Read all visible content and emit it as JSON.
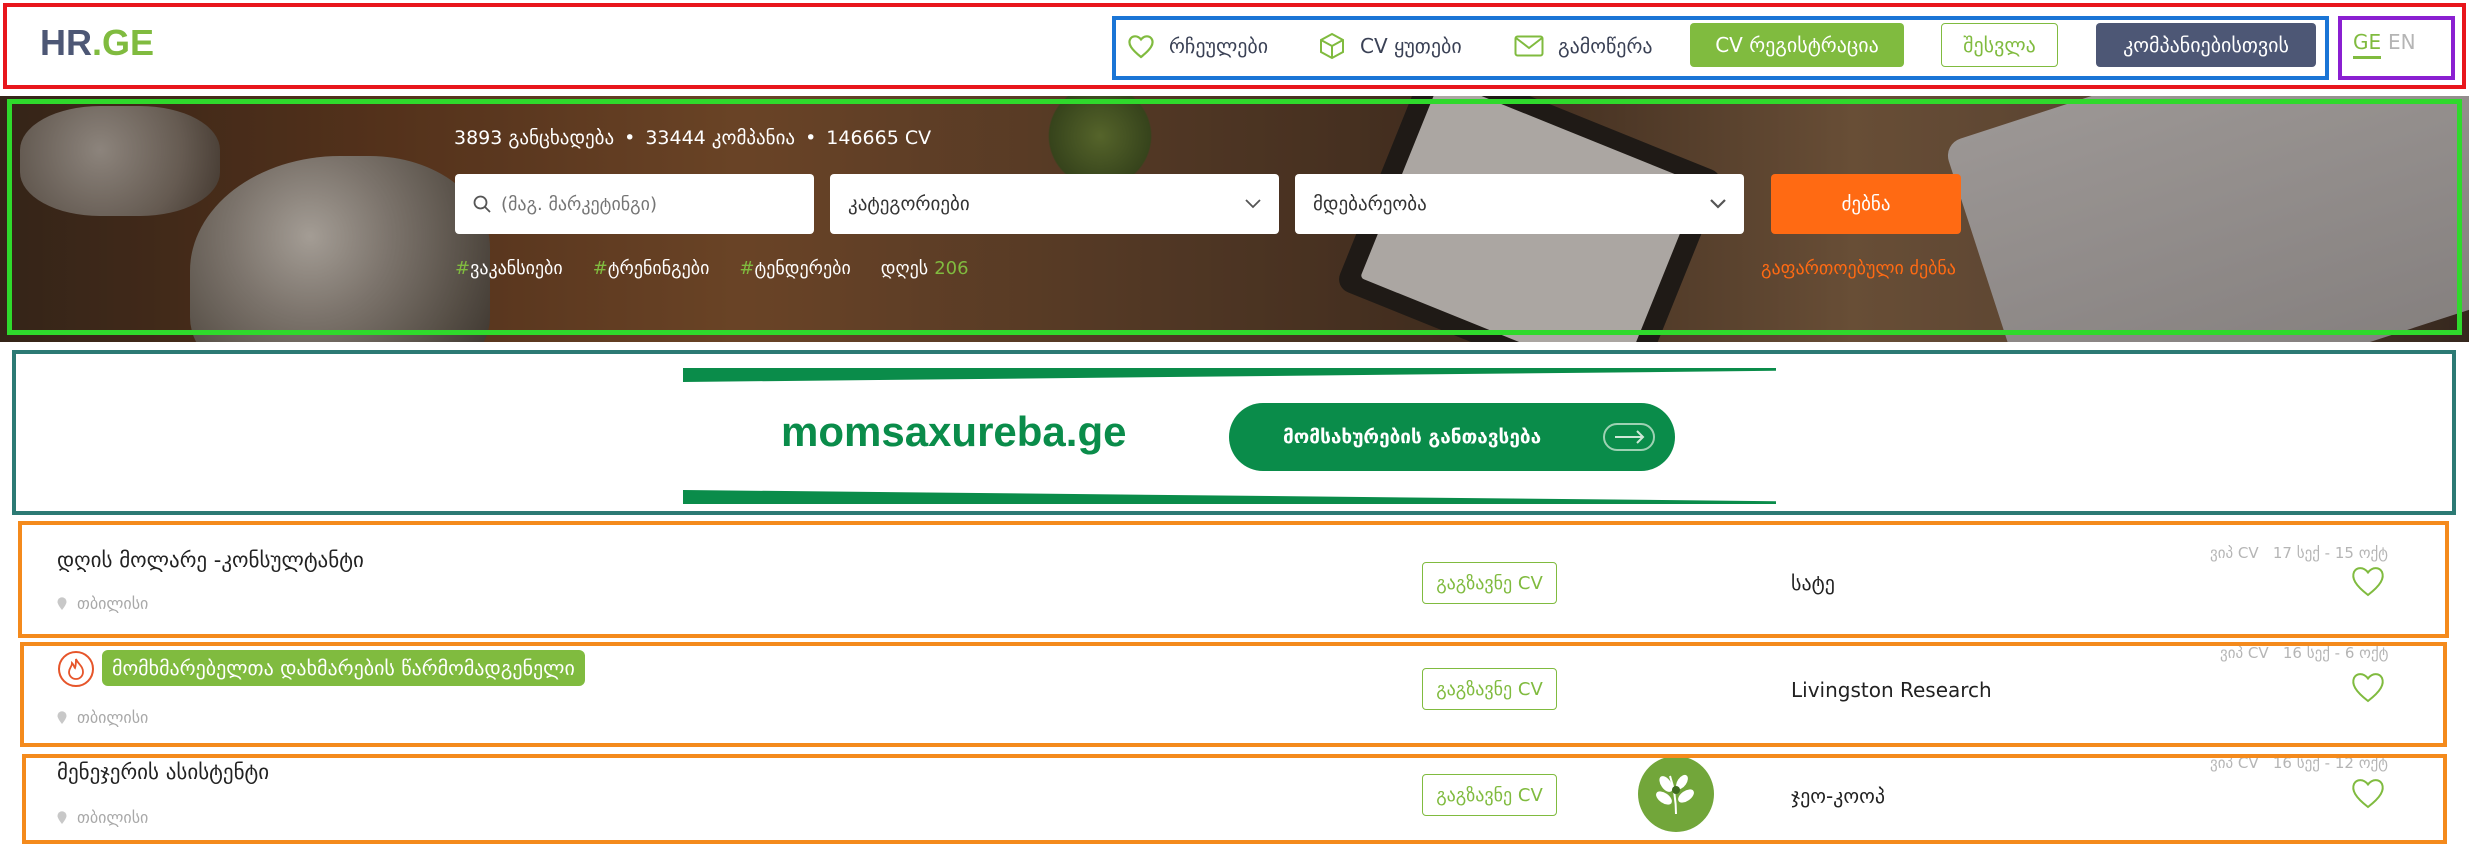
{
  "header": {
    "logo_hr": "HR",
    "logo_ge": ".GE",
    "nav": {
      "favorites": "რჩეულები",
      "cv_boxes": "CV ყუთები",
      "subscribe": "გამოწერა"
    },
    "cv_registration": "CV რეგისტრაცია",
    "login": "შესვლა",
    "for_companies": "კომპანიებისთვის",
    "lang_ge": "GE",
    "lang_en": "EN"
  },
  "hero": {
    "stats": {
      "applications": "3893 განცხადება",
      "companies": "33444 კომპანია",
      "cv": "146665 CV"
    },
    "search_placeholder": "(მაგ. მარკეტინგი)",
    "category_label": "კატეგორიები",
    "location_label": "მდებარეობა",
    "search_button": "ძებნა",
    "tags": [
      "ვაკანსიები",
      "ტრენინგები",
      "ტენდერები"
    ],
    "today_label": "დღეს",
    "today_count": "206",
    "advanced_search": "გაფართოებული ძებნა"
  },
  "banner": {
    "brand": "momsaxureba.ge",
    "button_label": "მომსახურების განთავსება"
  },
  "jobs": [
    {
      "title": "დღის მოლარე -კონსულტანტი",
      "location": "თბილისი",
      "send_cv": "გაგზავნე CV",
      "company": "სატე",
      "meta_type": "ვიპ CV",
      "meta_dates": "17 სექ - 15 ოქტ"
    },
    {
      "title": "მომხმარებელთა დახმარების წარმომადგენელი",
      "location": "თბილისი",
      "send_cv": "გაგზავნე CV",
      "company": "Livingston Research",
      "meta_type": "ვიპ CV",
      "meta_dates": "16 სექ - 6 ოქტ"
    },
    {
      "title": "მენეჯერის ასისტენტი",
      "location": "თბილისი",
      "send_cv": "გაგზავნე CV",
      "company": "ჯეო-კოოპ",
      "meta_type": "ვიპ CV",
      "meta_dates": "16 სექ - 12 ოქტ"
    }
  ],
  "colors": {
    "brand_green": "#80bb3f",
    "brand_navy": "#4d5775",
    "accent_orange": "#ff6a13",
    "banner_green": "#0a8c4a",
    "overlay_red": "#e8161c",
    "overlay_blue": "#1a75d6",
    "overlay_purple": "#8a1fd1",
    "overlay_green": "#2fd92c",
    "overlay_teal": "#2c7a74",
    "overlay_orange": "#f48a1c"
  }
}
